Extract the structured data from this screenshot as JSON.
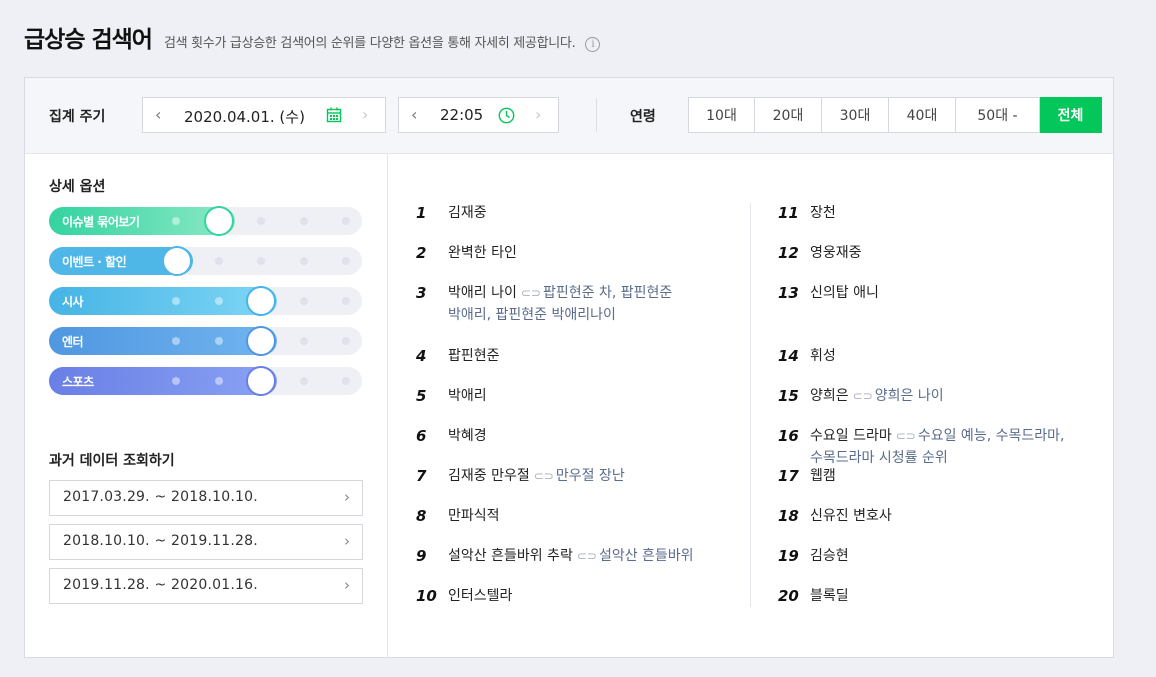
{
  "header": {
    "title": "급상승 검색어",
    "description": "검색 횟수가 급상승한 검색어의 순위를 다양한 옵션을 통해 자세히 제공합니다.",
    "info_glyph": "i"
  },
  "filters": {
    "period_label": "집계 주기",
    "date_value": "2020.04.01. (수)",
    "time_value": "22:05",
    "age_label": "연령",
    "ages": [
      "10대",
      "20대",
      "30대",
      "40대",
      "50대 -",
      "전체"
    ],
    "selected_age": "전체",
    "accent": "#03c75a"
  },
  "options": {
    "title": "상세 옵션",
    "toggles": [
      {
        "label": "이슈별 묶어보기",
        "level": "1/5"
      },
      {
        "label": "이벤트 · 할인",
        "level": "0/5"
      },
      {
        "label": "시사",
        "level": "2/5"
      },
      {
        "label": "엔터",
        "level": "2/5"
      },
      {
        "label": "스포츠",
        "level": "2/5"
      }
    ]
  },
  "past": {
    "title": "과거 데이터 조회하기",
    "ranges": [
      "2017.03.29. ~ 2018.10.10.",
      "2018.10.10. ~ 2019.11.28.",
      "2019.11.28. ~ 2020.01.16."
    ]
  },
  "ranking": [
    {
      "rank": "1",
      "keyword": "김재중",
      "related": ""
    },
    {
      "rank": "2",
      "keyword": "완벽한 타인",
      "related": ""
    },
    {
      "rank": "3",
      "keyword": "박애리 나이",
      "related": "팝핀현준 차, 팝핀현준",
      "related2": "박애리, 팝핀현준 박애리나이"
    },
    {
      "rank": "4",
      "keyword": "팝핀현준",
      "related": ""
    },
    {
      "rank": "5",
      "keyword": "박애리",
      "related": ""
    },
    {
      "rank": "6",
      "keyword": "박혜경",
      "related": ""
    },
    {
      "rank": "7",
      "keyword": "김재중 만우절",
      "related": "만우절 장난"
    },
    {
      "rank": "8",
      "keyword": "만파식적",
      "related": ""
    },
    {
      "rank": "9",
      "keyword": "설악산 흔들바위 추락",
      "related": "설악산 흔들바위"
    },
    {
      "rank": "10",
      "keyword": "인터스텔라",
      "related": ""
    },
    {
      "rank": "11",
      "keyword": "장천",
      "related": ""
    },
    {
      "rank": "12",
      "keyword": "영웅재중",
      "related": ""
    },
    {
      "rank": "13",
      "keyword": "신의탑 애니",
      "related": ""
    },
    {
      "rank": "14",
      "keyword": "휘성",
      "related": ""
    },
    {
      "rank": "15",
      "keyword": "양희은",
      "related": "양희은 나이"
    },
    {
      "rank": "16",
      "keyword": "수요일 드라마",
      "related": "수요일 예능, 수목드라마,",
      "related2": "수목드라마 시청률 순위"
    },
    {
      "rank": "17",
      "keyword": "웹캠",
      "related": ""
    },
    {
      "rank": "18",
      "keyword": "신유진 변호사",
      "related": ""
    },
    {
      "rank": "19",
      "keyword": "김승현",
      "related": ""
    },
    {
      "rank": "20",
      "keyword": "블록딜",
      "related": ""
    }
  ]
}
